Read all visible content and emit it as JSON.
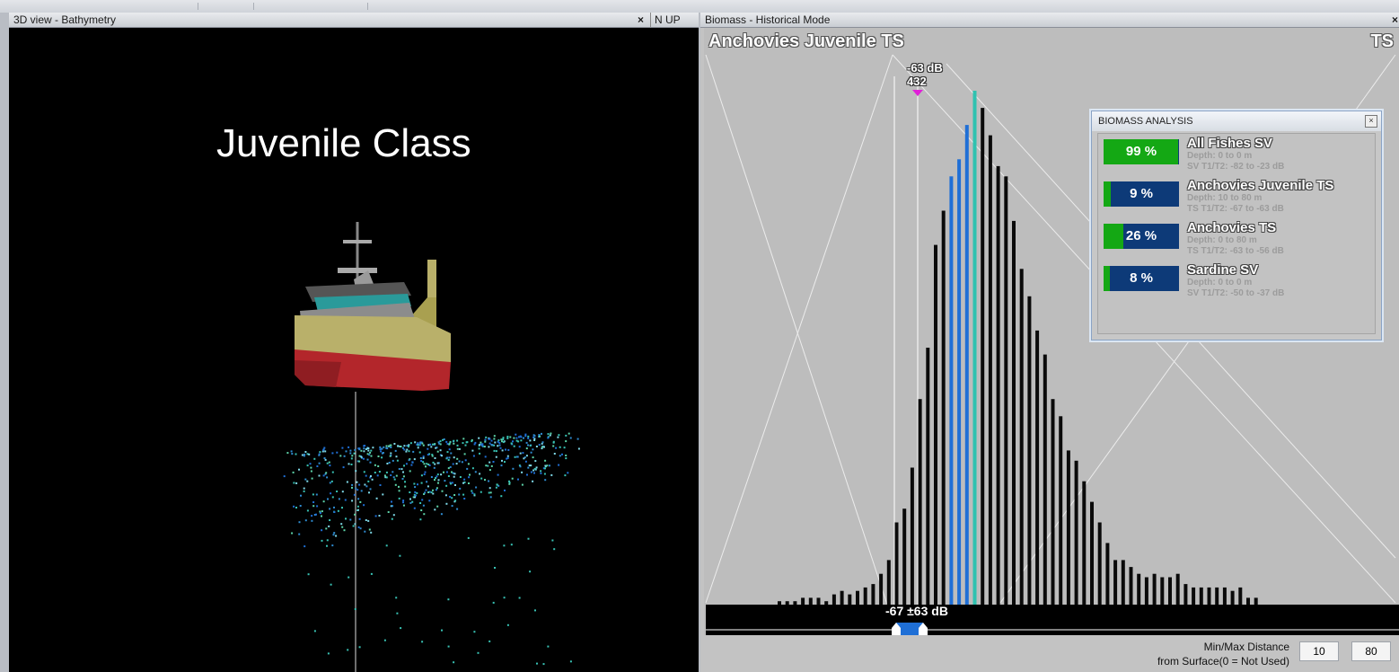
{
  "left_window": {
    "title": "3D view - Bathymetry",
    "close": "×",
    "north_up": "N UP"
  },
  "viewport_label": "Juvenile Class",
  "right_window": {
    "title": "Biomass - Historical Mode",
    "close": "×"
  },
  "histogram": {
    "title": "Anchovies Juvenile TS",
    "mode_label": "TS",
    "marker_db": "-63 dB",
    "marker_count": "432",
    "threshold_label": "-67 ±63 dB"
  },
  "chart_data": {
    "type": "bar",
    "title": "Anchovies Juvenile TS",
    "values": [
      1,
      1,
      1,
      2,
      2,
      2,
      1,
      3,
      4,
      3,
      4,
      5,
      6,
      9,
      13,
      24,
      28,
      40,
      60,
      75,
      105,
      115,
      125,
      130,
      140,
      150,
      145,
      137,
      128,
      125,
      112,
      98,
      90,
      80,
      73,
      60,
      55,
      45,
      42,
      36,
      30,
      24,
      18,
      13,
      13,
      11,
      9,
      8,
      9,
      8,
      8,
      9,
      6,
      5,
      5,
      5,
      5,
      5,
      4,
      5,
      2,
      2
    ],
    "highlight": {
      "blue_indices": [
        22,
        23,
        24
      ],
      "teal_indices": [
        25
      ]
    },
    "colors": {
      "bar": "#0a0a0a",
      "selected": "#1f6fd6",
      "marker": "#2fc2b0",
      "threshold": "#e020d8"
    }
  },
  "distance": {
    "label_line1": "Min/Max Distance",
    "label_line2": "from Surface(0 = Not Used)",
    "min": "10",
    "max": "80"
  },
  "biomass_panel": {
    "title": "BIOMASS ANALYSIS",
    "close": "×",
    "rows": [
      {
        "pct": "99 %",
        "fill": 0.99,
        "name": "All Fishes SV",
        "depth": "Depth: 0 to 0 m",
        "thr": "SV T1/T2: -82 to -23 dB"
      },
      {
        "pct": "9 %",
        "fill": 0.09,
        "name": "Anchovies Juvenile TS",
        "depth": "Depth: 10 to 80 m",
        "thr": "TS T1/T2: -67 to -63 dB"
      },
      {
        "pct": "26 %",
        "fill": 0.26,
        "name": "Anchovies TS",
        "depth": "Depth: 0 to 80 m",
        "thr": "TS T1/T2: -63 to -56 dB"
      },
      {
        "pct": "8 %",
        "fill": 0.08,
        "name": "Sardine SV",
        "depth": "Depth: 0 to 0 m",
        "thr": "SV T1/T2: -50 to -37 dB"
      }
    ]
  },
  "colors": {
    "green": "#14a814",
    "navy": "#0d3a78",
    "hull_red": "#b3262b",
    "hull_khaki": "#b9b06a",
    "deck_teal": "#2a9a9a"
  }
}
